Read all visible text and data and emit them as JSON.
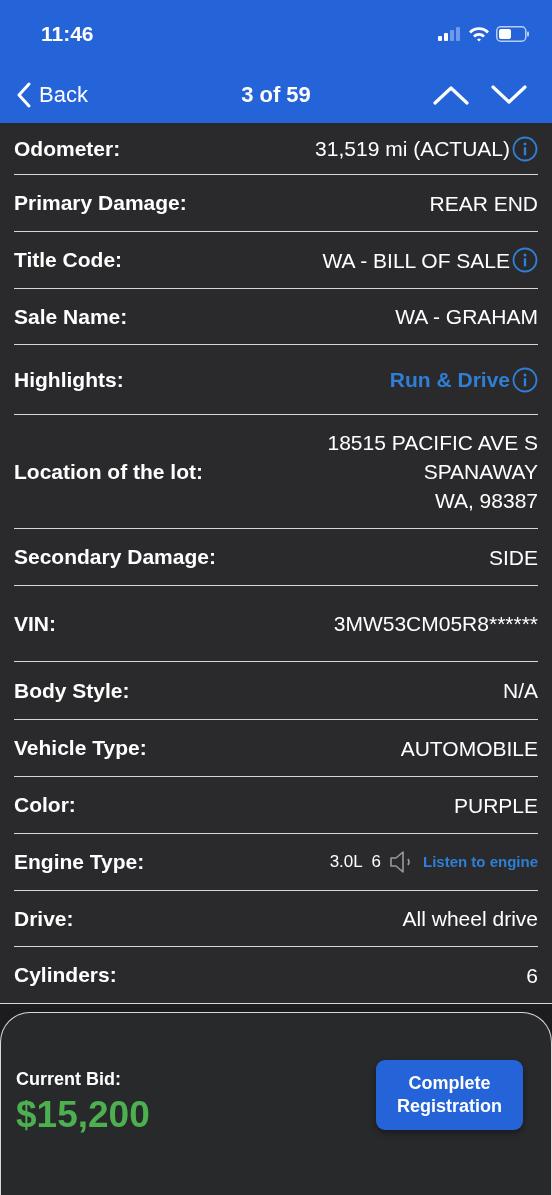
{
  "status_bar": {
    "time": "11:46"
  },
  "nav": {
    "back": "Back",
    "title": "3 of 59"
  },
  "rows": [
    {
      "kind": "text",
      "label": "Odometer:",
      "value": [
        "31,519 mi (ACTUAL)"
      ],
      "info": true
    },
    {
      "kind": "text",
      "label": "Primary Damage:",
      "value": [
        "REAR END"
      ],
      "info": false
    },
    {
      "kind": "text",
      "label": "Title Code:",
      "value": [
        "WA - BILL OF SALE"
      ],
      "info": true
    },
    {
      "kind": "text",
      "label": "Sale Name:",
      "value": [
        "WA - GRAHAM"
      ],
      "info": false
    },
    {
      "kind": "link",
      "label": "Highlights:",
      "value": [
        "Run & Drive"
      ],
      "info": true
    },
    {
      "kind": "text",
      "label": "Location of the lot:",
      "value": [
        "18515 PACIFIC AVE S",
        "SPANAWAY",
        "WA, 98387"
      ],
      "info": false
    },
    {
      "kind": "text",
      "label": "Secondary Damage:",
      "value": [
        "SIDE"
      ],
      "info": false
    },
    {
      "kind": "text",
      "label": "VIN:",
      "value": [
        "3MW53CM05R8******"
      ],
      "info": false
    },
    {
      "kind": "text",
      "label": "Body Style:",
      "value": [
        "N/A"
      ],
      "info": false
    },
    {
      "kind": "text",
      "label": "Vehicle Type:",
      "value": [
        "AUTOMOBILE"
      ],
      "info": false
    },
    {
      "kind": "text",
      "label": "Color:",
      "value": [
        "PURPLE"
      ],
      "info": false
    },
    {
      "kind": "engine",
      "label": "Engine Type:",
      "value": [
        "3.0L  6"
      ],
      "action": "Listen to engine",
      "info": false
    },
    {
      "kind": "text",
      "label": "Drive:",
      "value": [
        "All wheel drive"
      ],
      "info": false
    },
    {
      "kind": "text",
      "label": "Cylinders:",
      "value": [
        "6"
      ],
      "info": false
    }
  ],
  "bid": {
    "label": "Current Bid:",
    "amount": "$15,200",
    "button": "Complete Registration"
  }
}
